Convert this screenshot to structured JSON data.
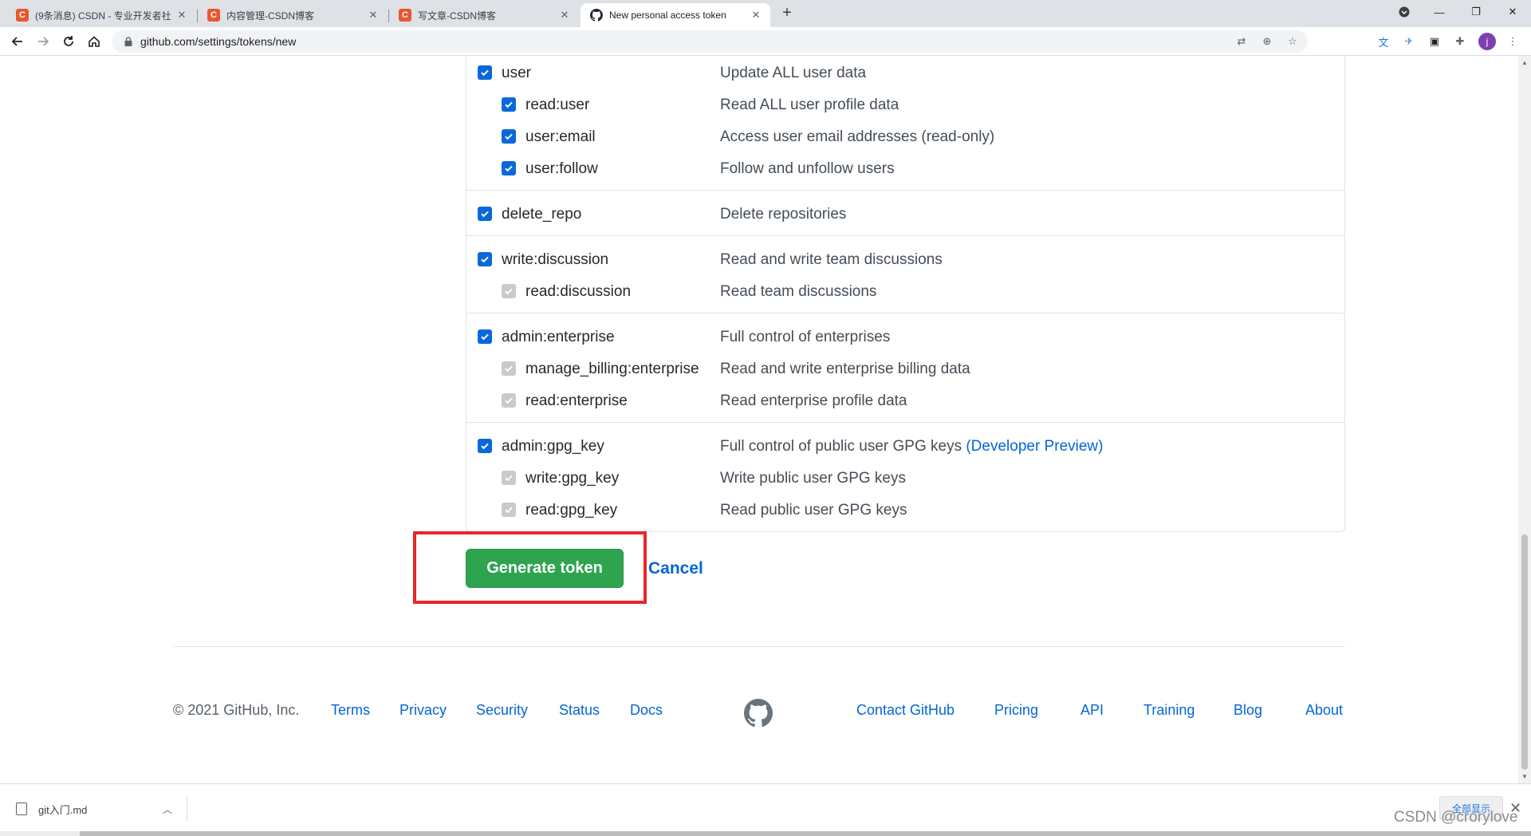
{
  "browser": {
    "tabs": [
      {
        "title": "(9条消息) CSDN - 专业开发者社",
        "favicon": "csdn-icon"
      },
      {
        "title": "内容管理-CSDN博客",
        "favicon": "csdn-icon"
      },
      {
        "title": "写文章-CSDN博客",
        "favicon": "csdn-icon"
      },
      {
        "title": "New personal access token",
        "favicon": "github-icon"
      }
    ],
    "url": "github.com/settings/tokens/new",
    "profile_initial": "j"
  },
  "scopes": [
    {
      "name": "user",
      "description": "Update ALL user data",
      "children": [
        {
          "name": "read:user",
          "description": "Read ALL user profile data"
        },
        {
          "name": "user:email",
          "description": "Access user email addresses (read-only)"
        },
        {
          "name": "user:follow",
          "description": "Follow and unfollow users"
        }
      ]
    },
    {
      "name": "delete_repo",
      "description": "Delete repositories",
      "children": []
    },
    {
      "name": "write:discussion",
      "description": "Read and write team discussions",
      "children": [
        {
          "name": "read:discussion",
          "description": "Read team discussions"
        }
      ]
    },
    {
      "name": "admin:enterprise",
      "description": "Full control of enterprises",
      "children": [
        {
          "name": "manage_billing:enterprise",
          "description": "Read and write enterprise billing data"
        },
        {
          "name": "read:enterprise",
          "description": "Read enterprise profile data"
        }
      ]
    },
    {
      "name": "admin:gpg_key",
      "description": "Full control of public user GPG keys",
      "description_link": "(Developer Preview)",
      "children": [
        {
          "name": "write:gpg_key",
          "description": "Write public user GPG keys"
        },
        {
          "name": "read:gpg_key",
          "description": "Read public user GPG keys"
        }
      ]
    }
  ],
  "actions": {
    "generate_label": "Generate token",
    "cancel_label": "Cancel"
  },
  "footer": {
    "copyright": "© 2021 GitHub, Inc.",
    "left_links": [
      "Terms",
      "Privacy",
      "Security",
      "Status",
      "Docs"
    ],
    "right_links": [
      "Contact GitHub",
      "Pricing",
      "API",
      "Training",
      "Blog",
      "About"
    ]
  },
  "downloads": {
    "file": "git入门.md",
    "show_all": "全部显示"
  },
  "watermark": "CSDN @crorylove",
  "colors": {
    "primary_button": "#2ea44f",
    "link": "#0366d6",
    "highlight_box": "#e8262a",
    "checkbox": "#0969da"
  }
}
